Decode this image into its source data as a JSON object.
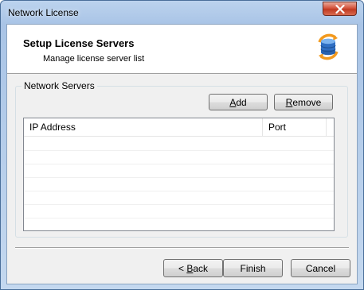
{
  "window": {
    "title": "Network License"
  },
  "header": {
    "title": "Setup License Servers",
    "subtitle": "Manage license server list",
    "icon": "database-sync-icon"
  },
  "group": {
    "label": "Network Servers",
    "add_button": {
      "mnemonic": "A",
      "rest": "dd"
    },
    "remove_button": {
      "mnemonic": "R",
      "rest": "emove"
    },
    "columns": [
      "IP Address",
      "Port"
    ],
    "rows": []
  },
  "footer": {
    "back_button": {
      "prefix": "< ",
      "mnemonic": "B",
      "rest": "ack"
    },
    "finish_button": "Finish",
    "cancel_button": "Cancel"
  },
  "colors": {
    "close_button": "#c8442c",
    "title_bar": "#a9c4e6",
    "dialog_bg": "#f0f0f0"
  }
}
